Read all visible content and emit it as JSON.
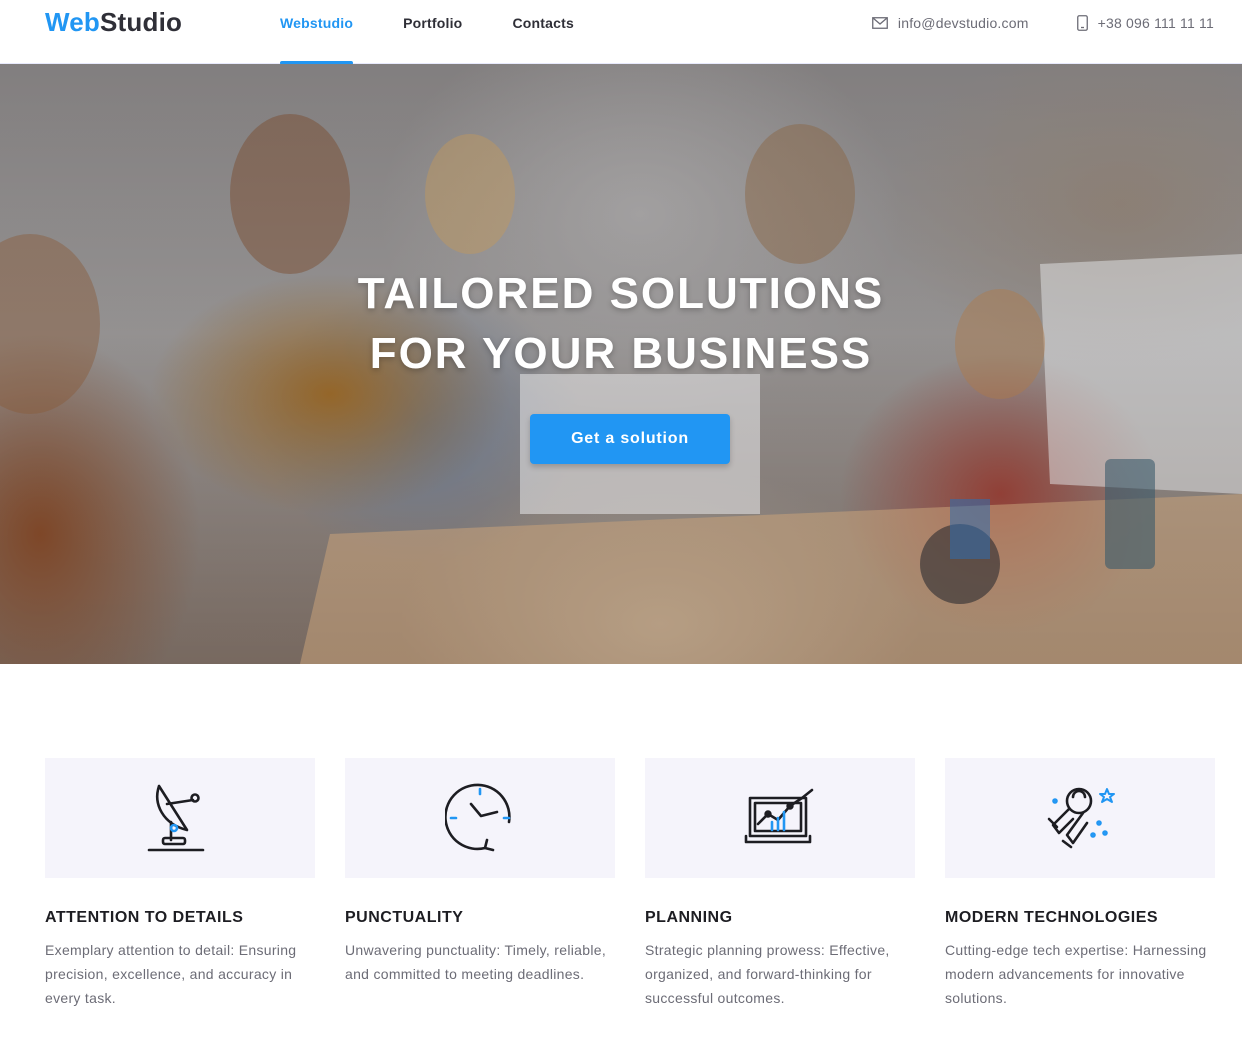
{
  "header": {
    "logo_part1": "Web",
    "logo_part2": "Studio",
    "nav": [
      {
        "label": "Webstudio",
        "active": true
      },
      {
        "label": "Portfolio",
        "active": false
      },
      {
        "label": "Contacts",
        "active": false
      }
    ],
    "email": "info@devstudio.com",
    "phone": "+38 096 111 11 11"
  },
  "hero": {
    "title_line1": "Tailored solutions",
    "title_line2": "for your business",
    "cta_label": "Get a solution"
  },
  "features": [
    {
      "icon": "satellite-dish-icon",
      "title": "Attention to details",
      "text": "Exemplary attention to detail: Ensuring precision, excellence, and accuracy in every task."
    },
    {
      "icon": "clock-icon",
      "title": "Punctuality",
      "text": "Unwavering punctuality: Timely, reliable, and committed to meeting deadlines."
    },
    {
      "icon": "laptop-chart-icon",
      "title": "Planning",
      "text": "Strategic planning prowess: Effective, organized, and forward-thinking for successful outcomes."
    },
    {
      "icon": "astronaut-icon",
      "title": "Modern technologies",
      "text": "Cutting-edge tech expertise: Harnessing modern advancements for innovative solutions."
    }
  ],
  "colors": {
    "accent": "#2196f3",
    "text_dark": "#2f2f37",
    "text_muted": "#6c6c76",
    "icon_bg": "#f5f4fb"
  }
}
